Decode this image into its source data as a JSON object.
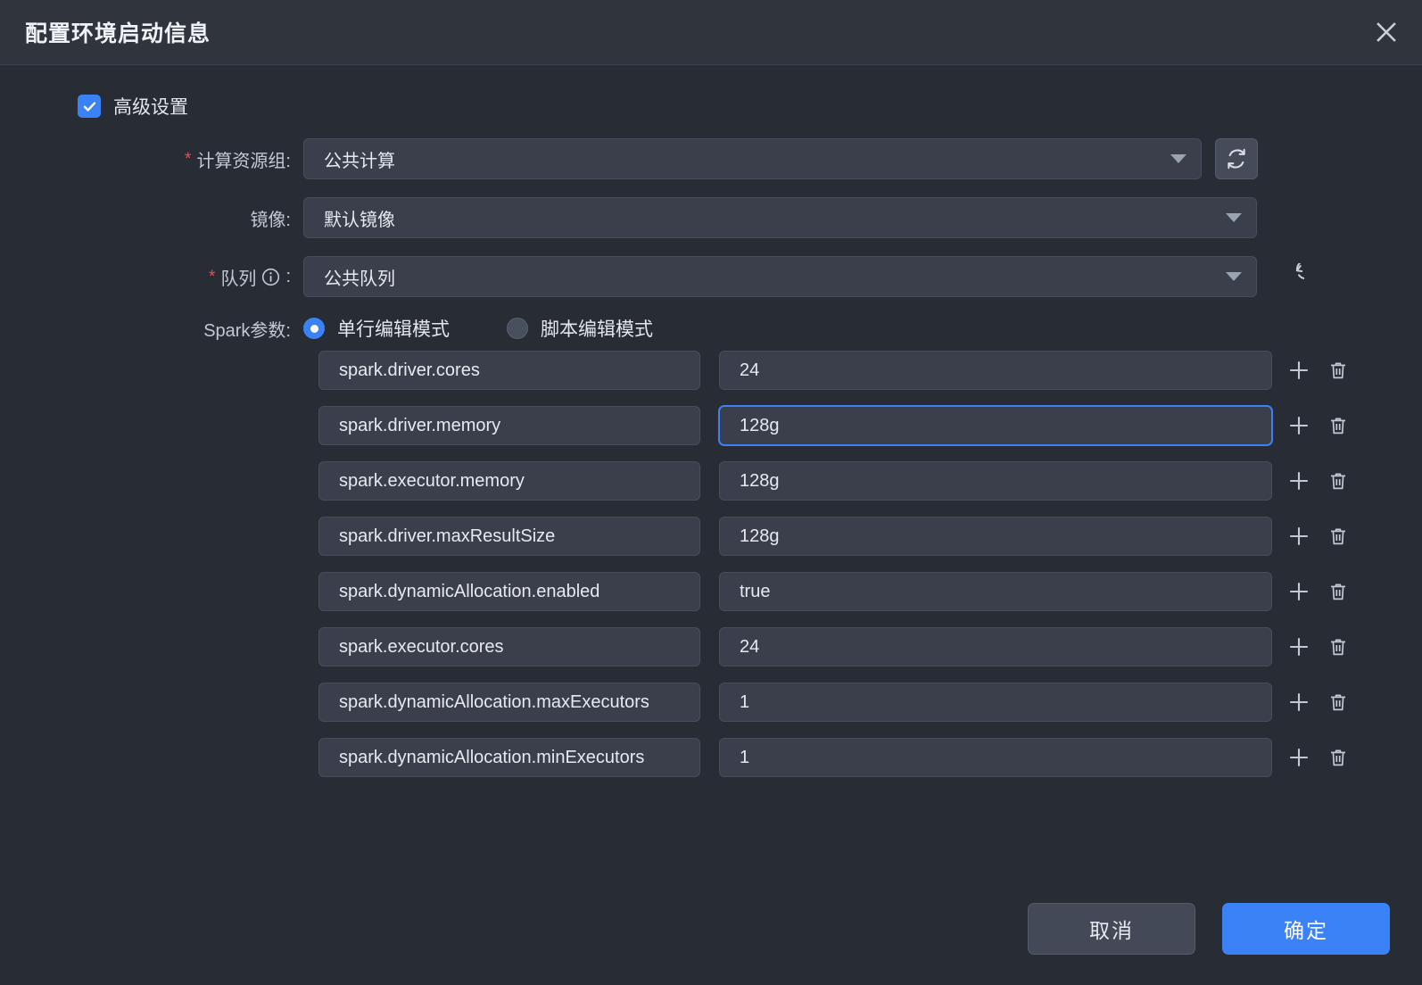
{
  "dialog": {
    "title": "配置环境启动信息",
    "close_icon": "close-icon"
  },
  "advanced": {
    "label": "高级设置",
    "checked": true
  },
  "fields": {
    "resource_group": {
      "label": "计算资源组:",
      "required": true,
      "value": "公共计算",
      "refresh_icon": "sync-refresh-icon"
    },
    "image": {
      "label": "镜像:",
      "required": false,
      "value": "默认镜像"
    },
    "queue": {
      "label": "队列",
      "label_suffix": ":",
      "required": true,
      "info_icon": "info-circle-icon",
      "value": "公共队列",
      "refresh_icon": "reload-icon"
    },
    "spark_params": {
      "label": "Spark参数:",
      "modes": [
        {
          "label": "单行编辑模式",
          "selected": true
        },
        {
          "label": "脚本编辑模式",
          "selected": false
        }
      ]
    }
  },
  "params": [
    {
      "key": "spark.driver.cores",
      "value": "24",
      "focused": false
    },
    {
      "key": "spark.driver.memory",
      "value": "128g",
      "focused": true
    },
    {
      "key": "spark.executor.memory",
      "value": "128g",
      "focused": false
    },
    {
      "key": "spark.driver.maxResultSize",
      "value": "128g",
      "focused": false
    },
    {
      "key": "spark.dynamicAllocation.enabled",
      "value": "true",
      "focused": false
    },
    {
      "key": "spark.executor.cores",
      "value": "24",
      "focused": false
    },
    {
      "key": "spark.dynamicAllocation.maxExecutors",
      "value": "1",
      "focused": false
    },
    {
      "key": "spark.dynamicAllocation.minExecutors",
      "value": "1",
      "focused": false
    }
  ],
  "row_actions": {
    "add_icon": "plus-icon",
    "delete_icon": "trash-icon"
  },
  "footer": {
    "cancel_label": "取消",
    "confirm_label": "确定"
  },
  "colors": {
    "accent": "#3b82f6",
    "required_star": "#f04c4c",
    "panel_bg": "#272c35",
    "header_bg": "#2f343d",
    "input_bg": "#3a3f4b"
  }
}
